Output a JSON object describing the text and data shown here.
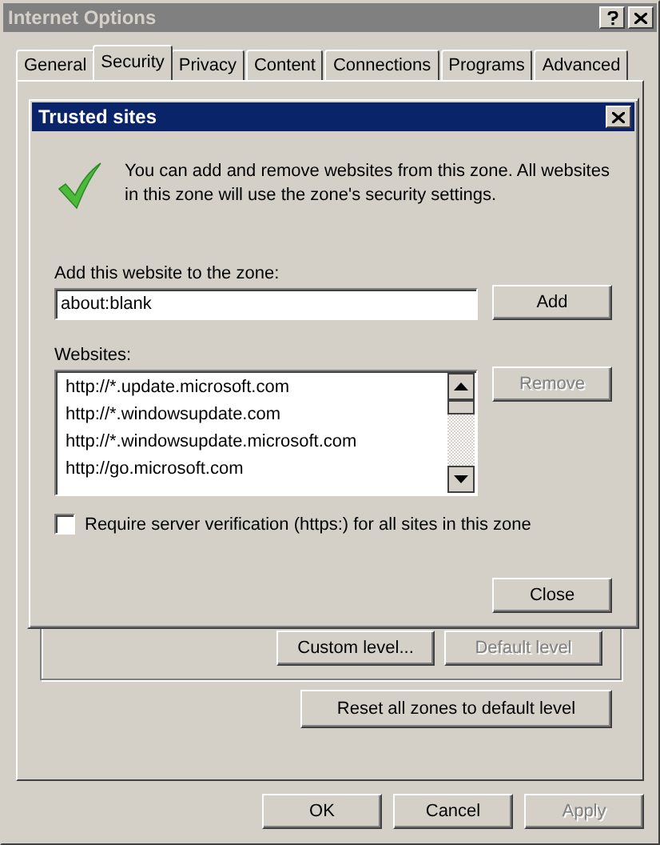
{
  "window": {
    "title": "Internet Options"
  },
  "tabs": [
    {
      "label": "General",
      "selected": false
    },
    {
      "label": "Security",
      "selected": true
    },
    {
      "label": "Privacy",
      "selected": false
    },
    {
      "label": "Content",
      "selected": false
    },
    {
      "label": "Connections",
      "selected": false
    },
    {
      "label": "Programs",
      "selected": false
    },
    {
      "label": "Advanced",
      "selected": false
    }
  ],
  "security_panel": {
    "level_buttons": [
      {
        "label": "Custom level...",
        "disabled": false
      },
      {
        "label": "Default level",
        "disabled": true
      }
    ],
    "reset_button": "Reset all zones to default level"
  },
  "buttons": [
    {
      "label": "OK",
      "disabled": false
    },
    {
      "label": "Cancel",
      "disabled": false
    },
    {
      "label": "Apply",
      "disabled": true
    }
  ],
  "trusted_sites": {
    "title": "Trusted sites",
    "description": "You can add and remove websites from this zone. All websites in this zone will use the zone's security settings.",
    "add_label": "Add this website to the zone:",
    "add_value": "about:blank",
    "add_button": {
      "label": "Add",
      "disabled": false
    },
    "websites_label": "Websites:",
    "websites": [
      "http://*.update.microsoft.com",
      "http://*.windowsupdate.com",
      "http://*.windowsupdate.microsoft.com",
      "http://go.microsoft.com"
    ],
    "remove_button": {
      "label": "Remove",
      "disabled": true
    },
    "require_https": {
      "label": "Require server verification (https:) for all sites in this zone",
      "checked": false
    },
    "close_button": {
      "label": "Close",
      "disabled": false
    }
  }
}
